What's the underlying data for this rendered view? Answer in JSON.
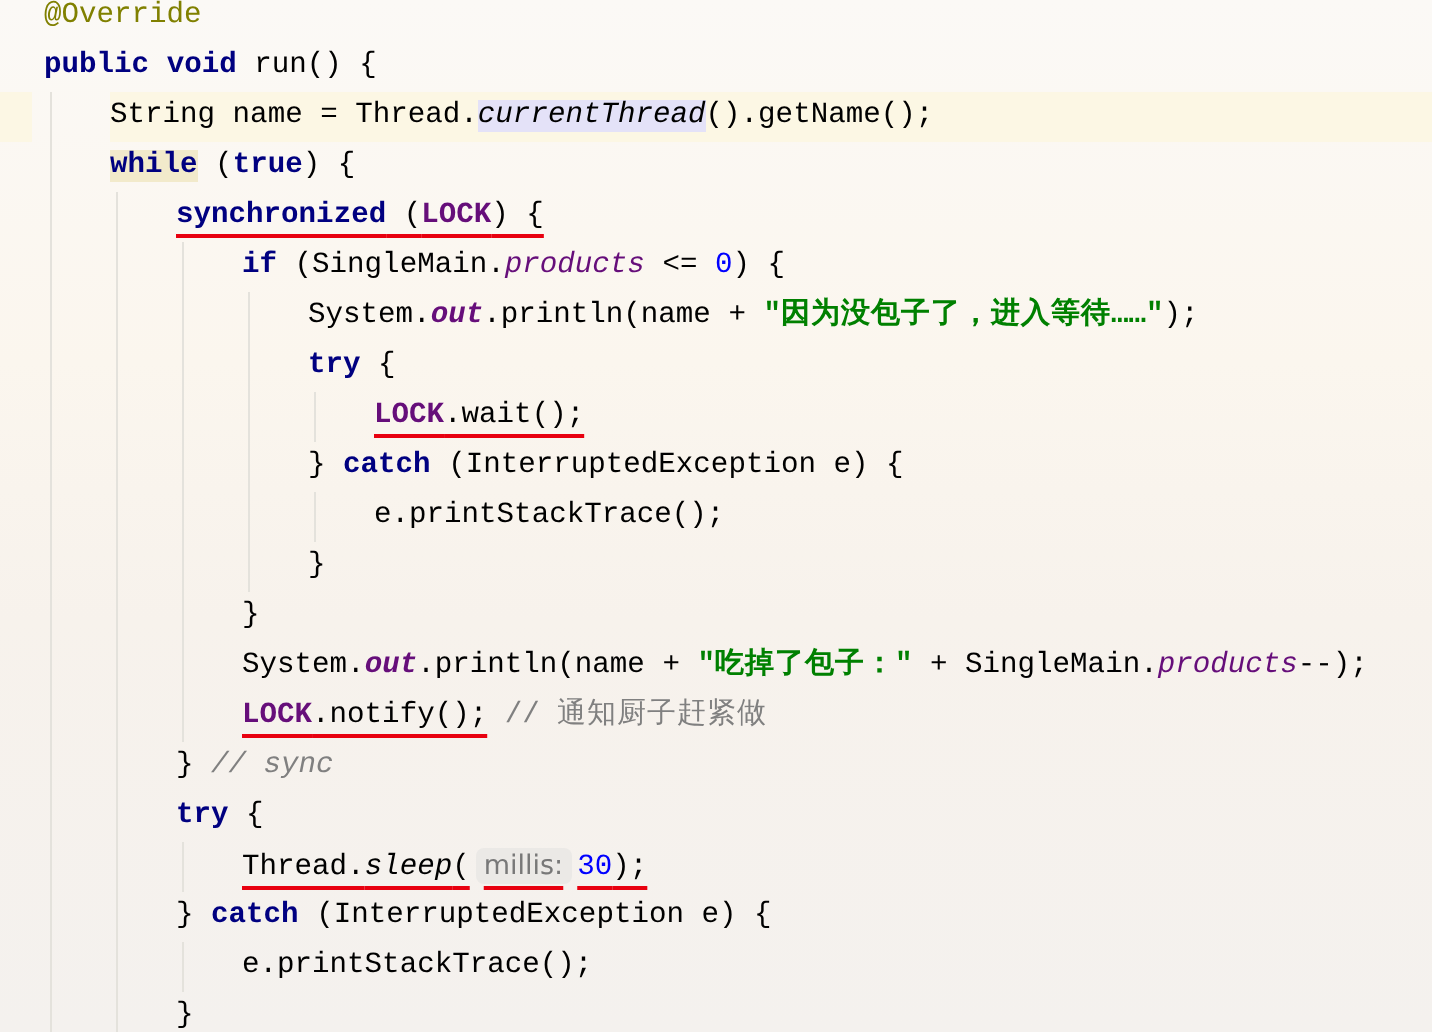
{
  "lines": [
    {
      "tokens": [
        {
          "text": "@Override",
          "kind": "annotation"
        }
      ]
    },
    {
      "tokens": [
        {
          "text": "public ",
          "kind": "keyword"
        },
        {
          "text": "void",
          "kind": "keyword"
        },
        {
          "text": " run() {",
          "kind": "plain"
        }
      ],
      "children": [
        {
          "current": true,
          "tokens": [
            {
              "text": "String name = Thread.",
              "kind": "plain"
            },
            {
              "text": "currentThread",
              "kind": "static-method",
              "color": "#e4e2f8"
            },
            {
              "text": "().getName();",
              "kind": "plain"
            }
          ]
        },
        {
          "tokens": [
            {
              "text": "while",
              "kind": "keyword",
              "color": "#f2eacb"
            },
            {
              "text": " (",
              "kind": "plain"
            },
            {
              "text": "true",
              "kind": "keyword"
            },
            {
              "text": ") {",
              "kind": "plain"
            }
          ],
          "children": [
            {
              "tokens": [
                {
                  "text": "synchronized",
                  "kind": "keyword",
                  "underlined": true
                },
                {
                  "text": " (",
                  "kind": "plain",
                  "underlined": true
                },
                {
                  "text": "LOCK",
                  "kind": "constant",
                  "underlined": true
                },
                {
                  "text": ") {",
                  "kind": "plain",
                  "underlined": true
                }
              ],
              "children": [
                {
                  "tokens": [
                    {
                      "text": "if",
                      "kind": "keyword"
                    },
                    {
                      "text": " (SingleMain.",
                      "kind": "plain"
                    },
                    {
                      "text": "products",
                      "kind": "field"
                    },
                    {
                      "text": " <= ",
                      "kind": "plain"
                    },
                    {
                      "text": "0",
                      "kind": "number"
                    },
                    {
                      "text": ") {",
                      "kind": "plain"
                    }
                  ],
                  "children": [
                    {
                      "tokens": [
                        {
                          "text": "System.",
                          "kind": "plain"
                        },
                        {
                          "text": "out",
                          "kind": "static-field"
                        },
                        {
                          "text": ".println(name + ",
                          "kind": "plain"
                        },
                        {
                          "text": "\"因为没包子了，进入等待……\"",
                          "kind": "string"
                        },
                        {
                          "text": ");",
                          "kind": "plain"
                        }
                      ]
                    },
                    {
                      "tokens": [
                        {
                          "text": "try",
                          "kind": "keyword"
                        },
                        {
                          "text": " {",
                          "kind": "plain"
                        }
                      ],
                      "children": [
                        {
                          "tokens": [
                            {
                              "text": "LOCK",
                              "kind": "constant",
                              "underlined": true
                            },
                            {
                              "text": ".wait();",
                              "kind": "plain",
                              "underlined": true
                            }
                          ]
                        }
                      ]
                    },
                    {
                      "tokens": [
                        {
                          "text": "} ",
                          "kind": "plain"
                        },
                        {
                          "text": "catch",
                          "kind": "keyword"
                        },
                        {
                          "text": " (InterruptedException e) {",
                          "kind": "plain"
                        }
                      ],
                      "children": [
                        {
                          "tokens": [
                            {
                              "text": "e.printStackTrace();",
                              "kind": "plain"
                            }
                          ]
                        }
                      ]
                    },
                    {
                      "tokens": [
                        {
                          "text": "}",
                          "kind": "plain"
                        }
                      ]
                    }
                  ]
                },
                {
                  "tokens": [
                    {
                      "text": "}",
                      "kind": "plain"
                    }
                  ]
                },
                {
                  "tokens": [
                    {
                      "text": "System.",
                      "kind": "plain"
                    },
                    {
                      "text": "out",
                      "kind": "static-field"
                    },
                    {
                      "text": ".println(name + ",
                      "kind": "plain"
                    },
                    {
                      "text": "\"吃掉了包子：\"",
                      "kind": "string"
                    },
                    {
                      "text": " + SingleMain.",
                      "kind": "plain"
                    },
                    {
                      "text": "products",
                      "kind": "field"
                    },
                    {
                      "text": "--);",
                      "kind": "plain"
                    }
                  ]
                },
                {
                  "tokens": [
                    {
                      "text": "LOCK",
                      "kind": "constant",
                      "underlined": true
                    },
                    {
                      "text": ".notify();",
                      "kind": "plain",
                      "underlined": true
                    },
                    {
                      "text": " // 通知厨子赶紧做",
                      "kind": "comment"
                    }
                  ]
                }
              ]
            },
            {
              "tokens": [
                {
                  "text": "} ",
                  "kind": "plain"
                },
                {
                  "text": "// sync",
                  "kind": "comment-italic"
                }
              ]
            },
            {
              "tokens": [
                {
                  "text": "try",
                  "kind": "keyword"
                },
                {
                  "text": " {",
                  "kind": "plain"
                }
              ],
              "children": [
                {
                  "tokens": [
                    {
                      "text": "Thread.",
                      "kind": "plain",
                      "underlined": true
                    },
                    {
                      "text": "sleep",
                      "kind": "static-method",
                      "underlined": true
                    },
                    {
                      "text": "(",
                      "kind": "plain",
                      "underlined": true
                    },
                    {
                      "text": "millis:",
                      "kind": "hint",
                      "underlined": true
                    },
                    {
                      "text": "30",
                      "kind": "number",
                      "underlined": true
                    },
                    {
                      "text": ");",
                      "kind": "plain",
                      "underlined": true
                    }
                  ]
                }
              ]
            },
            {
              "tokens": [
                {
                  "text": "} ",
                  "kind": "plain"
                },
                {
                  "text": "catch",
                  "kind": "keyword"
                },
                {
                  "text": " (InterruptedException e) {",
                  "kind": "plain"
                }
              ],
              "children": [
                {
                  "tokens": [
                    {
                      "text": "e.printStackTrace();",
                      "kind": "plain"
                    }
                  ]
                }
              ]
            },
            {
              "tokens": [
                {
                  "text": "}",
                  "kind": "plain"
                }
              ]
            }
          ]
        }
      ]
    }
  ]
}
